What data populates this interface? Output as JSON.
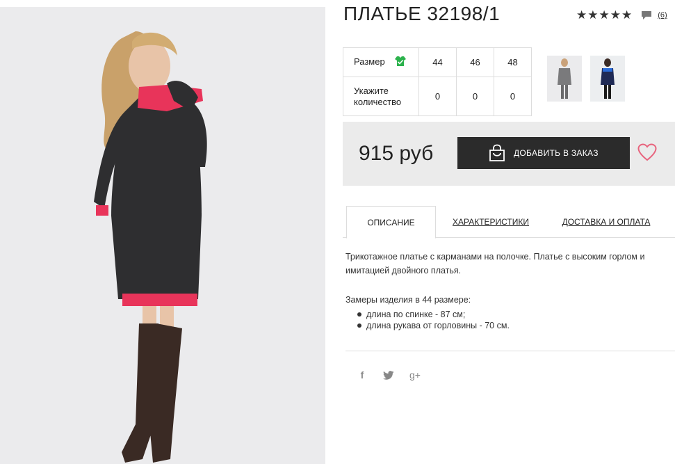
{
  "product": {
    "title": "ПЛАТЬЕ 32198/1",
    "rating_stars": "★★★★★",
    "review_count": "(6)"
  },
  "sizes": {
    "size_label": "Размер",
    "qty_label": "Укажите количество",
    "options": [
      {
        "size": "44",
        "qty": "0"
      },
      {
        "size": "46",
        "qty": "0"
      },
      {
        "size": "48",
        "qty": "0"
      }
    ]
  },
  "buy": {
    "price": "915 руб",
    "add_button_label": "ДОБАВИТЬ В ЗАКАЗ"
  },
  "tabs": [
    {
      "label": "ОПИСАНИЕ"
    },
    {
      "label": "ХАРАКТЕРИСТИКИ"
    },
    {
      "label": "ДОСТАВКА И ОПЛАТА"
    }
  ],
  "description": {
    "text": "Трикотажное платье с карманами на полочке. Платье с высоким горлом и имитацией двойного платья.",
    "measure_title": "Замеры изделия в 44 размере:",
    "measures": [
      "длина по спинке - 87 см;",
      "длина рукава от горловины - 70 см."
    ]
  },
  "social": {
    "facebook": "f",
    "googleplus": "g+"
  },
  "colors": {
    "accent_pink": "#e8637d",
    "button_dark": "#2b2b2b",
    "hanger_green": "#2bb24c"
  },
  "icons": [
    "star-icon",
    "comment-icon",
    "hanger-icon",
    "bag-icon",
    "heart-icon",
    "facebook-icon",
    "twitter-icon",
    "googleplus-icon"
  ]
}
